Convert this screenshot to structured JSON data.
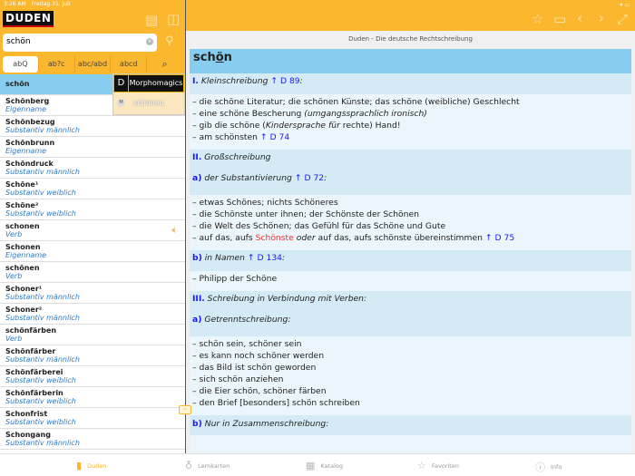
{
  "status": {
    "time": "3:26 AM",
    "date": "Freitag 31. Juli"
  },
  "header": {
    "logo": "DUDEN",
    "page_title": "Duden - Die deutsche Rechtschreibung"
  },
  "search": {
    "value": "schön"
  },
  "modes": [
    "abQ",
    "ab?c",
    "abc/abd",
    "abcd",
    "doc-search"
  ],
  "list": [
    {
      "w": "schön",
      "t": ""
    },
    {
      "w": "Schönberg",
      "t": "Eigenname"
    },
    {
      "w": "Schönbezug",
      "t": "Substantiv männlich"
    },
    {
      "w": "Schönbrunn",
      "t": "Eigenname"
    },
    {
      "w": "Schöndruck",
      "t": "Substantiv männlich"
    },
    {
      "w": "Schöne¹",
      "t": "Substantiv weiblich"
    },
    {
      "w": "Schöne²",
      "t": "Substantiv weiblich"
    },
    {
      "w": "schonen",
      "t": "Verb"
    },
    {
      "w": "Schonen",
      "t": "Eigenname"
    },
    {
      "w": "schönen",
      "t": "Verb"
    },
    {
      "w": "Schoner¹",
      "t": "Substantiv männlich"
    },
    {
      "w": "Schoner²",
      "t": "Substantiv männlich"
    },
    {
      "w": "schönfärben",
      "t": "Verb"
    },
    {
      "w": "Schönfärber",
      "t": "Substantiv männlich"
    },
    {
      "w": "Schönfärberei",
      "t": "Substantiv weiblich"
    },
    {
      "w": "Schönfärberin",
      "t": "Substantiv weiblich"
    },
    {
      "w": "Schonfrist",
      "t": "Substantiv weiblich"
    },
    {
      "w": "Schongang",
      "t": "Substantiv männlich"
    }
  ],
  "morph": {
    "d": "D",
    "title": "Morphomagics",
    "m": "M",
    "word": "schönen"
  },
  "entry": {
    "hw_a": "sch",
    "hw_b": "ö",
    "hw_c": "n",
    "s1": {
      "num": "I.",
      "label": "Kleinschreibung",
      "ref": "↑ D 89",
      "colon": ":"
    },
    "ex1": [
      "– die schöne Literatur; die schönen Künste; das schöne (weibliche) Geschlecht",
      "– eine schöne Bescherung ",
      "(umgangssprachlich ironisch)",
      "– gib die schöne (",
      "Kindersprache für",
      " rechte) Hand!",
      "– am schönsten ",
      "↑ D 74"
    ],
    "s2": {
      "num": "II.",
      "label": "Großschreibung"
    },
    "s2a": {
      "num": "a)",
      "label": "der Substantivierung",
      "ref": "↑ D 72",
      "colon": ":"
    },
    "ex2": [
      "– etwas Schönes; nichts Schöneres",
      "– die Schönste unter ihnen; der Schönste der Schönen",
      "– die Welt des Schönen; das Gefühl für das Schöne und Gute",
      "– auf das, aufs ",
      "Schönste",
      " oder",
      " auf das, aufs schönste übereinstimmen ",
      "↑ D 75"
    ],
    "s2b": {
      "num": "b)",
      "label": "in Namen",
      "ref": "↑ D 134",
      "colon": ":"
    },
    "ex3": [
      "– Philipp der Schöne"
    ],
    "s3": {
      "num": "III.",
      "label": "Schreibung in Verbindung mit Verben:"
    },
    "s3a": {
      "num": "a)",
      "label": "Getrenntschreibung:"
    },
    "ex4": [
      "– schön sein, schöner sein",
      "– es kann noch schöner werden",
      "– das Bild ist schön geworden",
      "– sich schön anziehen",
      "– die Eier schön, schöner färben",
      "– den Brief [besonders] schön schreiben"
    ],
    "s3b": {
      "num": "b)",
      "label": "Nur in Zusammenschreibung:"
    }
  },
  "tabs": [
    "Duden",
    "Lernkarten",
    "Katalog",
    "Favoriten",
    "Info"
  ],
  "colors": {
    "accent": "#fbb72e",
    "headword_bg": "#87cdef",
    "link": "#1a1aee"
  }
}
